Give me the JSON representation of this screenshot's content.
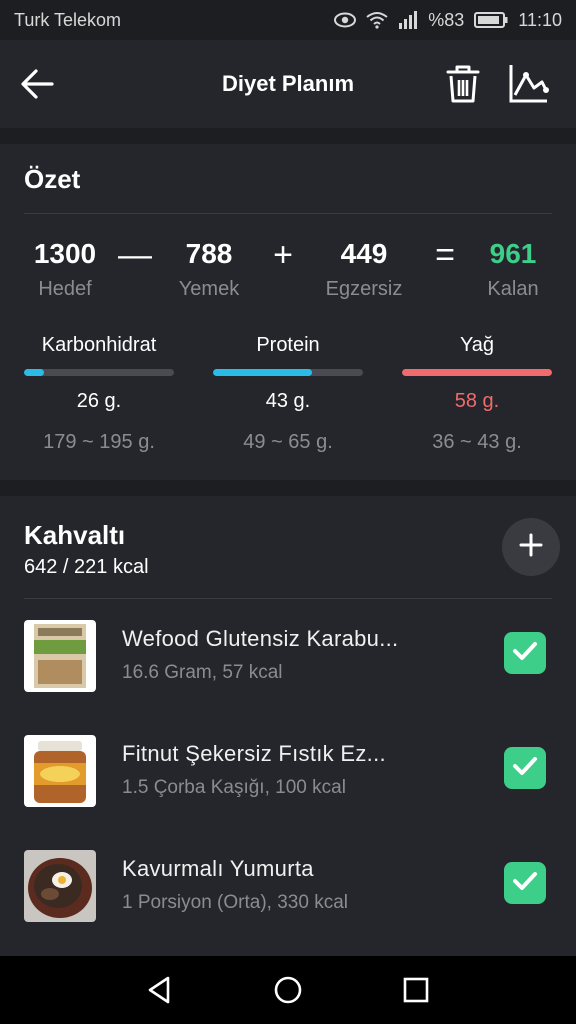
{
  "status_bar": {
    "carrier": "Turk Telekom",
    "battery": "%83",
    "time": "11:10"
  },
  "app_bar": {
    "title": "Diyet Planım"
  },
  "summary": {
    "title": "Özet",
    "goal": {
      "value": "1300",
      "label": "Hedef"
    },
    "food": {
      "value": "788",
      "label": "Yemek"
    },
    "exercise": {
      "value": "449",
      "label": "Egzersiz"
    },
    "remaining": {
      "value": "961",
      "label": "Kalan"
    },
    "operators": {
      "minus": "—",
      "plus": "+",
      "equals": "="
    },
    "macros": [
      {
        "label": "Karbonhidrat",
        "value": "26 g.",
        "range": "179 ~ 195 g.",
        "progress": 0.13
      },
      {
        "label": "Protein",
        "value": "43 g.",
        "range": "49 ~ 65 g.",
        "progress": 0.66
      },
      {
        "label": "Yağ",
        "value": "58 g.",
        "range": "36 ~ 43 g.",
        "progress": 1.0
      }
    ]
  },
  "meal": {
    "title": "Kahvaltı",
    "subtitle": "642 / 221 kcal",
    "items": [
      {
        "name": "Wefood Glutensiz Karabu...",
        "detail": "16.6 Gram, 57 kcal",
        "checked": true
      },
      {
        "name": "Fitnut Şekersiz Fıstık Ez...",
        "detail": "1.5 Çorba Kaşığı, 100 kcal",
        "checked": true
      },
      {
        "name": "Kavurmalı Yumurta",
        "detail": "1 Porsiyon (Orta), 330 kcal",
        "checked": true
      }
    ]
  },
  "colors": {
    "background": "#1d1e22",
    "card": "#25262c",
    "accent_green": "#3dcf8a",
    "remaining_green": "#3dcf8a",
    "carb_protein_bar": "#2bbce6",
    "fat_red": "#f06b6b",
    "muted_text": "#8b8c92"
  },
  "icons": {
    "back": "arrow-left-icon",
    "delete": "trash-icon",
    "stats": "line-chart-icon",
    "add": "plus-icon",
    "check": "check-icon",
    "nav_back": "triangle-back-icon",
    "nav_home": "circle-home-icon",
    "nav_recent": "square-recent-icon"
  }
}
